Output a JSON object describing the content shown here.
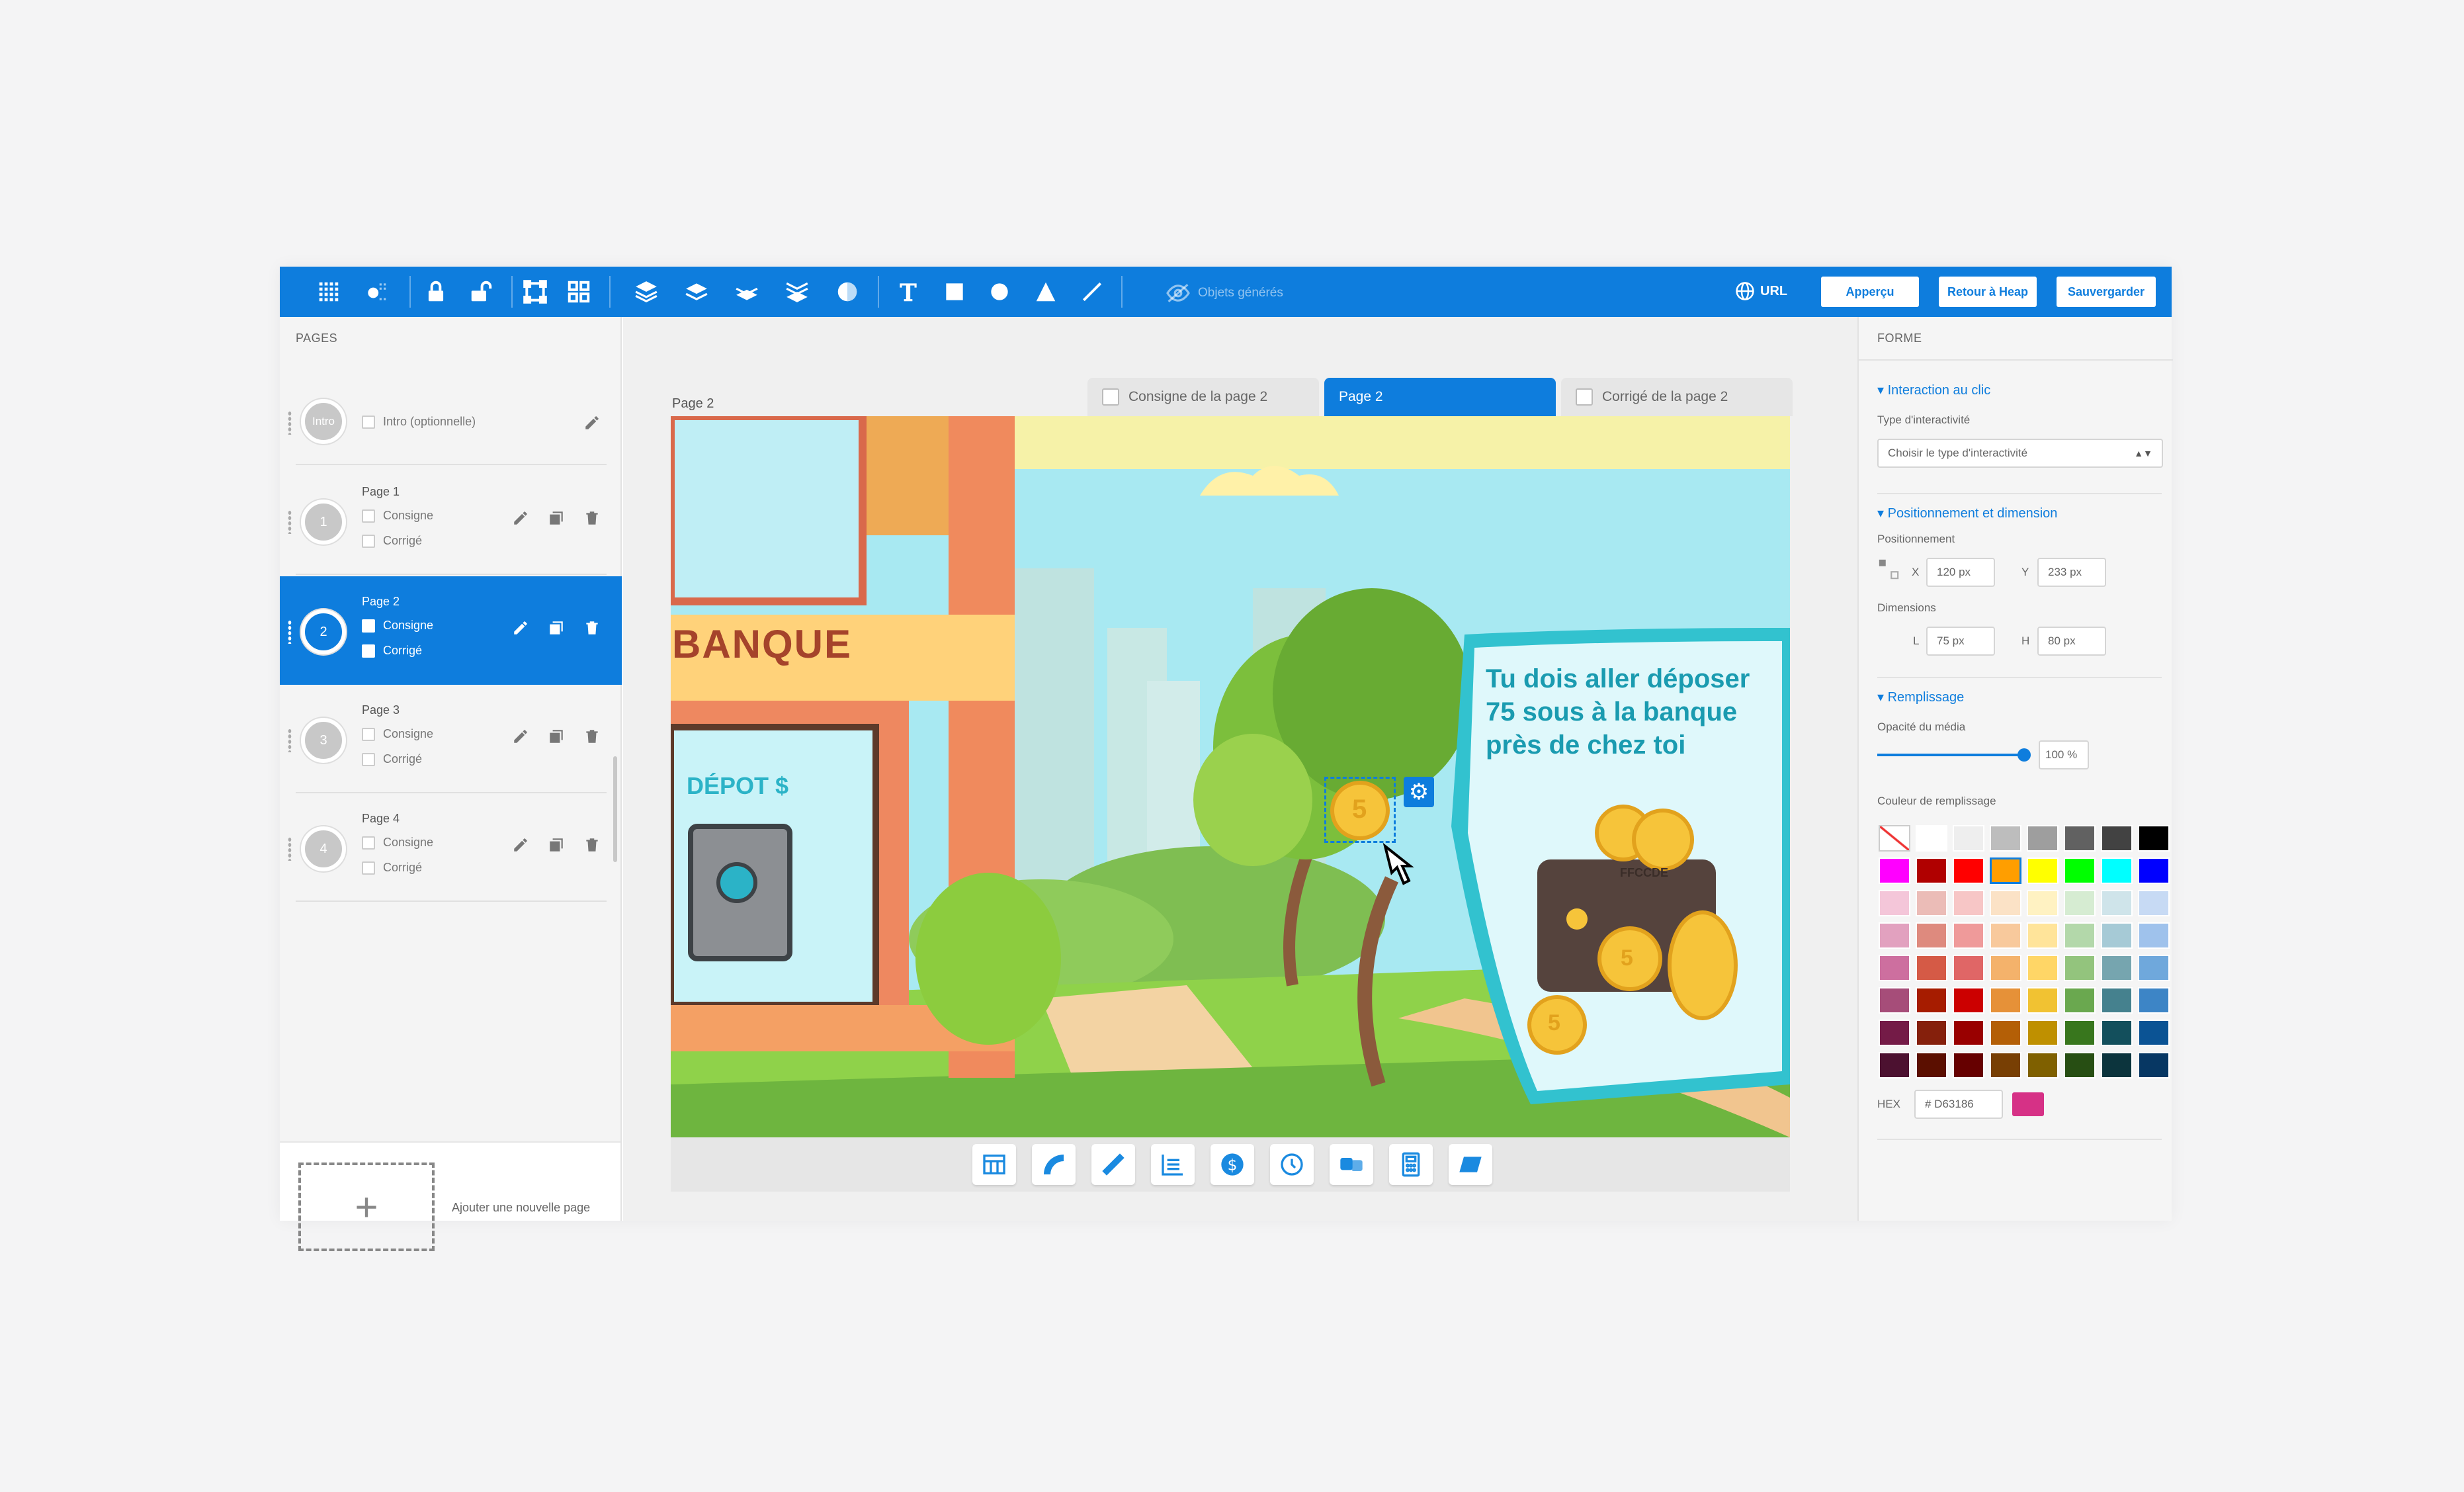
{
  "toolbar": {
    "generated_label": "Objets générés",
    "url_label": "URL",
    "preview_label": "Apperçu",
    "back_label": "Retour à Heap",
    "save_label": "Sauvergarder",
    "accent": "#0e7ddd"
  },
  "sidebar": {
    "title": "PAGES",
    "intro_label": "Intro",
    "intro_option": "Intro (optionnelle)",
    "pages": [
      {
        "num": "1",
        "title": "Page 1",
        "consigne": "Consigne",
        "corrige": "Corrigé"
      },
      {
        "num": "2",
        "title": "Page 2",
        "consigne": "Consigne",
        "corrige": "Corrigé"
      },
      {
        "num": "3",
        "title": "Page 3",
        "consigne": "Consigne",
        "corrige": "Corrigé"
      },
      {
        "num": "4",
        "title": "Page 4",
        "consigne": "Consigne",
        "corrige": "Corrigé"
      }
    ],
    "add_label": "Ajouter une nouvelle page",
    "add_icon": "+"
  },
  "canvas": {
    "page_label": "Page 2",
    "tabs": [
      "Consigne de la page 2",
      "Page 2",
      "Corrigé de la page 2"
    ],
    "scene_text": "Tu dois aller déposer 75 sous à la banque près de chez toi",
    "bank_text": "BANQUE",
    "depot_text": "DÉPOT $",
    "coin_value": "5",
    "wallet_text": "FFCCDE"
  },
  "panel": {
    "title": "FORME",
    "interaction_head": "Interaction au clic",
    "interaction_type_label": "Type d'interactivité",
    "interaction_select": "Choisir le type d'interactivité",
    "position_head": "Positionnement et dimension",
    "position_label": "Positionnement",
    "x_label": "X",
    "x_value": "120 px",
    "y_label": "Y",
    "y_value": "233 px",
    "dim_label": "Dimensions",
    "l_label": "L",
    "l_value": "75 px",
    "h_label": "H",
    "h_value": "80 px",
    "fill_head": "Remplissage",
    "opacity_label": "Opacité du média",
    "opacity_value": "100 %",
    "opacity_fraction": 1.0,
    "fill_color_label": "Couleur de remplissage",
    "hex_label": "HEX",
    "hex_value": "# D63186",
    "hex_color": "#d63186"
  }
}
